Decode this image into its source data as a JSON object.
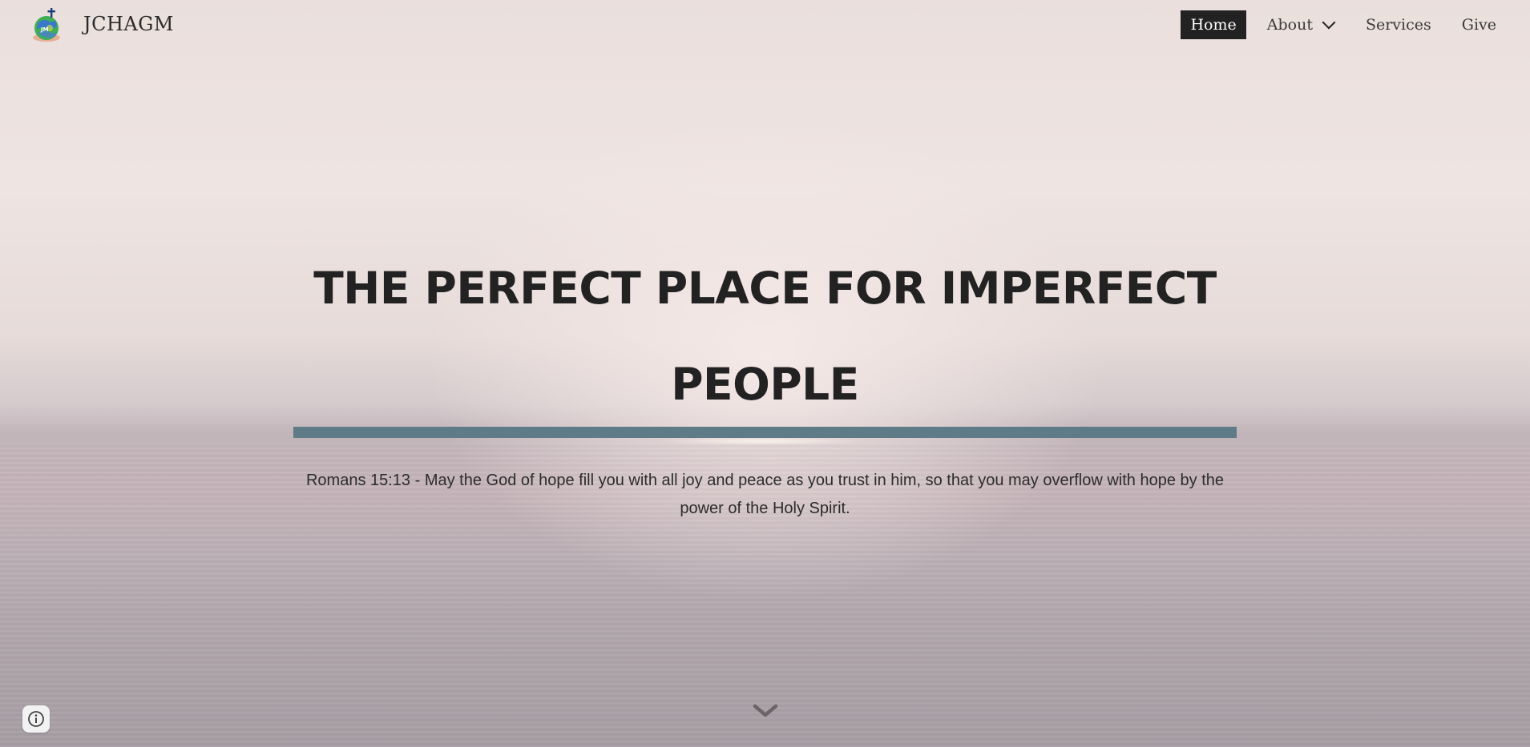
{
  "site": {
    "title": "JCHAGM",
    "logo_icon": "globe-cross-logo-icon"
  },
  "nav": {
    "items": [
      {
        "label": "Home",
        "active": true
      },
      {
        "label": "About",
        "active": false,
        "has_dropdown": true
      },
      {
        "label": "Services",
        "active": false
      },
      {
        "label": "Give",
        "active": false
      }
    ]
  },
  "hero": {
    "heading_line1": "THE PERFECT PLACE FOR IMPERFECT",
    "heading_line2": "PEOPLE",
    "verse": "Romans 15:13 - May the God of hope fill you with all joy and peace as you trust in him, so that you may overflow with hope by the power of the Holy Spirit."
  },
  "icons": {
    "scroll": "chevron-down-icon",
    "info": "info-icon",
    "about_dropdown": "chevron-down-icon"
  },
  "colors": {
    "accent_bar": "#5f7b87",
    "nav_active_bg": "#222222",
    "text_dark": "#222222"
  }
}
